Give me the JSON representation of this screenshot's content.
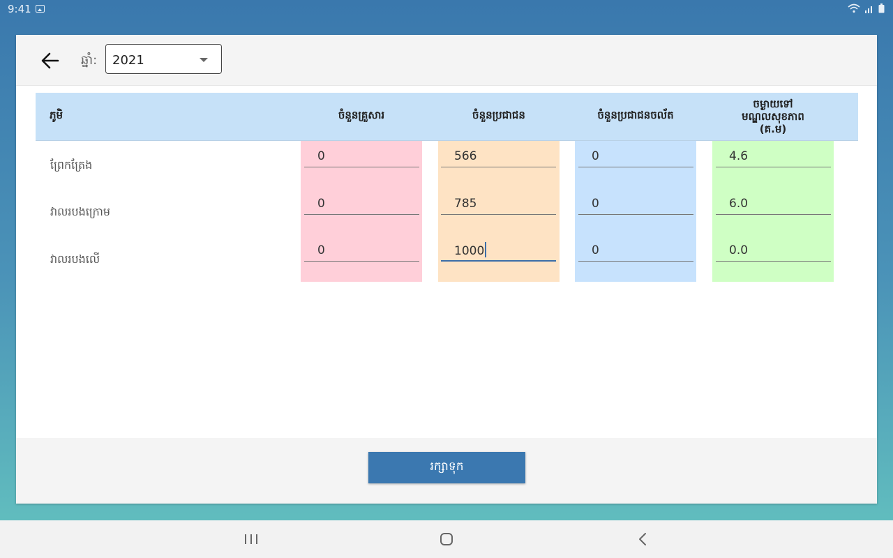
{
  "status_bar": {
    "time": "9:41",
    "icons": [
      "gallery-icon",
      "wifi-icon",
      "signal-icon",
      "battery-icon"
    ]
  },
  "toolbar": {
    "back_icon": "arrow-left-icon",
    "year_label": "ឆ្នាំ:",
    "year_value": "2021"
  },
  "table": {
    "headers": {
      "village": "ភូមិ",
      "families": "ចំនួនគ្រួសារ",
      "population": "ចំនួនប្រជាជន",
      "mobile_population": "ចំនួនប្រជាជនចល័ត",
      "distance_line1": "ចម្ងាយទៅ",
      "distance_line2": "មណ្ឌលសុខភាព",
      "distance_line3": "(គ.ម)"
    },
    "rows": [
      {
        "village": "ព្រែកត្រែង",
        "families": "0",
        "population": "566",
        "mobile_population": "0",
        "distance": "4.6"
      },
      {
        "village": "វាលរបងក្រោម",
        "families": "0",
        "population": "785",
        "mobile_population": "0",
        "distance": "6.0"
      },
      {
        "village": "វាលរបងលើ",
        "families": "0",
        "population": "1000",
        "mobile_population": "0",
        "distance": "0.0"
      }
    ]
  },
  "footer": {
    "save_label": "រក្សាទុក"
  },
  "colors": {
    "families_column": "#ffcfd9",
    "population_column": "#fee3c4",
    "mobile_column": "#c7e2fd",
    "distance_column": "#cfffc4",
    "header_bg": "#c6e1f8",
    "primary": "#3b78b0"
  },
  "nav_bar": {
    "icons": [
      "recent-apps-icon",
      "home-icon",
      "back-nav-icon"
    ]
  }
}
